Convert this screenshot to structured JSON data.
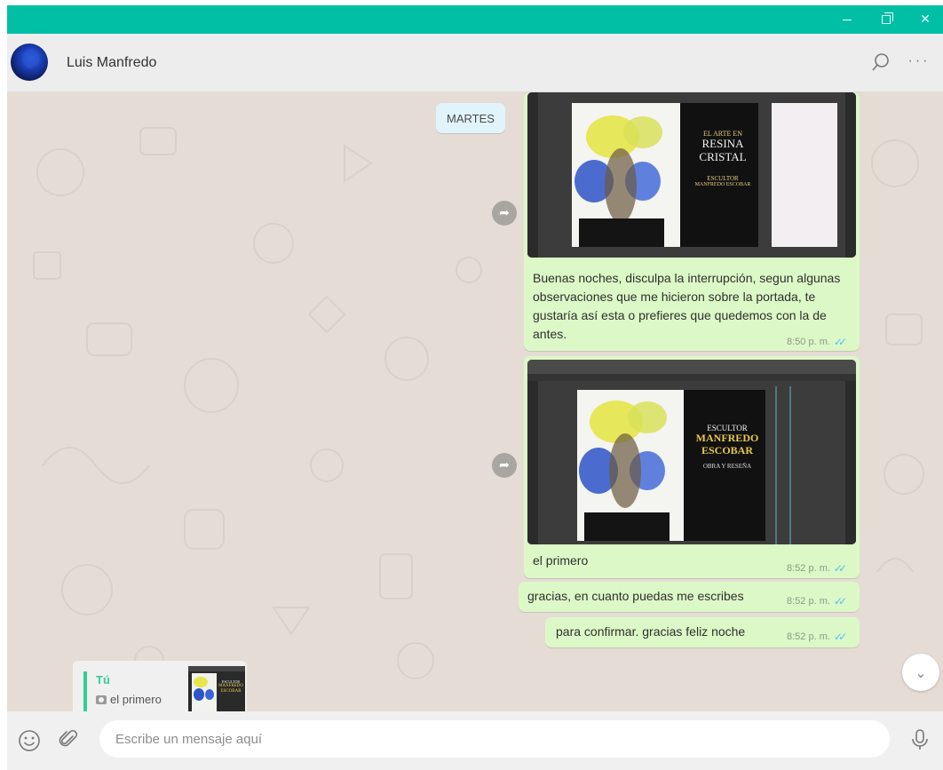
{
  "window": {
    "minimize_icon": "minimize-icon",
    "maximize_icon": "restore-icon",
    "close_icon": "close-icon",
    "accent": "#00bfa5"
  },
  "header": {
    "contact_name": "Luis Manfredo",
    "search_icon": "search-icon",
    "menu_icon": "more-options-icon"
  },
  "chat": {
    "date_chip": "MARTES",
    "bubble_color": "#dcf8c6",
    "messages": [
      {
        "type": "image",
        "image": {
          "caption_line1": "EL ARTE EN",
          "caption_line2": "RESINA",
          "caption_line3": "CRISTAL",
          "caption_line4": "ESCULTOR",
          "caption_line5": "MANFREDO ESCOBAR"
        },
        "text": "Buenas noches, disculpa la interrupción, segun algunas observaciones que me hicieron sobre la portada, te gustaría así esta o prefieres que quedemos con la de antes.",
        "time": "8:50 p. m."
      },
      {
        "type": "image",
        "image": {
          "caption_line1": "ESCULTOR",
          "caption_line2": "MANFREDO",
          "caption_line3": "ESCOBAR",
          "caption_line4": "OBRA Y RESEÑA"
        },
        "text": "el primero",
        "time": "8:52 p. m."
      },
      {
        "type": "text",
        "text": "gracias, en cuanto puedas me escribes",
        "time": "8:52 p. m."
      },
      {
        "type": "text",
        "text": "para confirmar. gracias feliz noche",
        "time": "8:52 p. m."
      }
    ],
    "scroll_down_icon": "chevron-down-icon"
  },
  "reply_preview": {
    "author": "Tú",
    "text": "el primero",
    "thumb_line1": "ESCULTOR",
    "thumb_line2": "MANFREDO",
    "thumb_line3": "ESCOBAR"
  },
  "composer": {
    "placeholder": "Escribe un mensaje aquí",
    "value": "",
    "emoji_icon": "emoji-icon",
    "attach_icon": "paperclip-icon",
    "mic_icon": "microphone-icon"
  }
}
